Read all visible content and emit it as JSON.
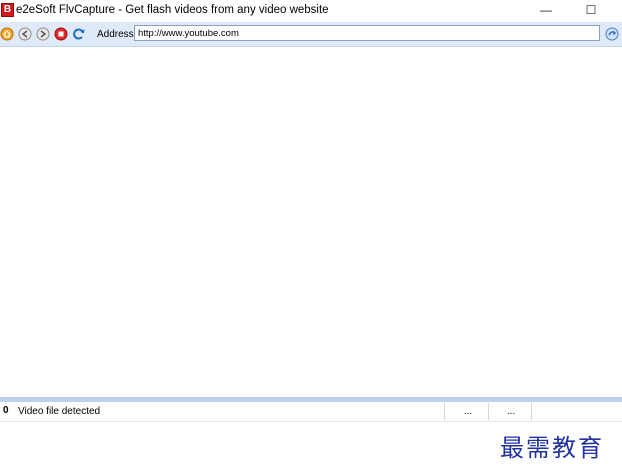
{
  "window": {
    "icon_letter": "B",
    "title": "e2eSoft FlvCapture - Get flash videos from any video website",
    "minimize_glyph": "—",
    "maximize_glyph": "☐"
  },
  "toolbar": {
    "icons": [
      "home-icon",
      "back-icon",
      "forward-icon",
      "stop-icon",
      "refresh-icon"
    ],
    "address_label": "Address:",
    "address_value": "http://www.youtube.com",
    "go_icon": "go-icon"
  },
  "statusbar": {
    "icon_glyph": "0",
    "status_text": "Video file detected",
    "panel1": "...",
    "panel2": "..."
  },
  "watermark": "最需教育",
  "colors": {
    "toolbar_bg": "#dfe9f8",
    "status_strip": "#bcd0ef"
  }
}
